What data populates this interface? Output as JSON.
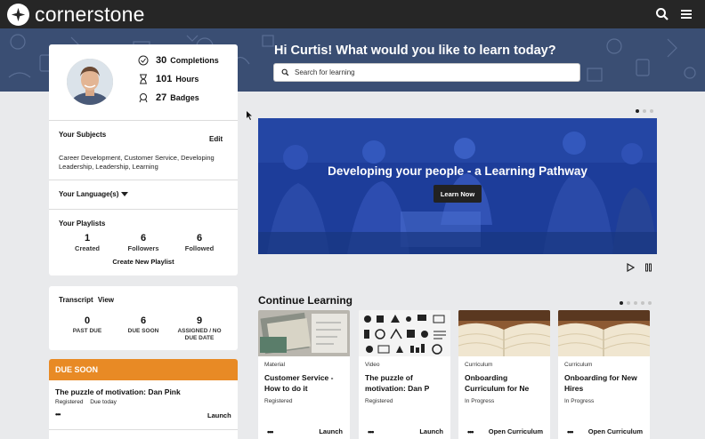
{
  "header": {
    "brand": "cornerstone",
    "icons": [
      "cornerstone-logo-icon",
      "search-icon",
      "menu-icon"
    ]
  },
  "hero": {
    "greeting": "Hi Curtis! What would you like to learn today?",
    "search_placeholder": "Search for learning"
  },
  "profile": {
    "stats": [
      {
        "value": "30",
        "label": "Completions",
        "icon": "check-circle-icon"
      },
      {
        "value": "101",
        "label": "Hours",
        "icon": "hourglass-icon"
      },
      {
        "value": "27",
        "label": "Badges",
        "icon": "badge-icon"
      }
    ],
    "subjects": {
      "title": "Your Subjects",
      "edit_label": "Edit",
      "line1": "Career Development, Customer Service, Developing",
      "line2": "Leadership, Leadership, Learning"
    },
    "languages_label": "Your Language(s)",
    "playlists": {
      "title": "Your Playlists",
      "items": [
        {
          "value": "1",
          "label": "Created"
        },
        {
          "value": "6",
          "label": "Followers"
        },
        {
          "value": "6",
          "label": "Followed"
        }
      ],
      "create_label": "Create New Playlist"
    }
  },
  "transcript": {
    "title": "Transcript",
    "view_label": "View",
    "items": [
      {
        "value": "0",
        "label1": "PAST DUE",
        "label2": ""
      },
      {
        "value": "6",
        "label1": "DUE SOON",
        "label2": ""
      },
      {
        "value": "9",
        "label1": "ASSIGNED / NO",
        "label2": "DUE DATE"
      }
    ]
  },
  "due_soon": {
    "header": "DUE SOON",
    "item_title": "The puzzle of motivation: Dan Pink",
    "item_status": "Registered",
    "item_due": "Due today",
    "more_label": "•••",
    "action_label": "Launch"
  },
  "carousel": {
    "title": "Developing your people - a Learning Pathway",
    "button_label": "Learn Now",
    "slide_count": 3,
    "active_slide": 1
  },
  "continue_learning": {
    "title": "Continue Learning",
    "page_count": 5,
    "active_page": 1,
    "courses": [
      {
        "type": "Material",
        "title1": "Customer Service -",
        "title2": "How to do it",
        "status": "Registered",
        "more": "•••",
        "action": "Launch"
      },
      {
        "type": "Video",
        "title1": "The puzzle of",
        "title2": "motivation: Dan P",
        "status": "Registered",
        "more": "•••",
        "action": "Launch"
      },
      {
        "type": "Curriculum",
        "title1": "Onboarding",
        "title2": "Curriculum for Ne",
        "status": "In Progress",
        "more": "•••",
        "action": "Open Curriculum"
      },
      {
        "type": "Curriculum",
        "title1": "Onboarding for New",
        "title2": "Hires",
        "status": "In Progress",
        "more": "•••",
        "action": "Open Curriculum"
      }
    ]
  }
}
